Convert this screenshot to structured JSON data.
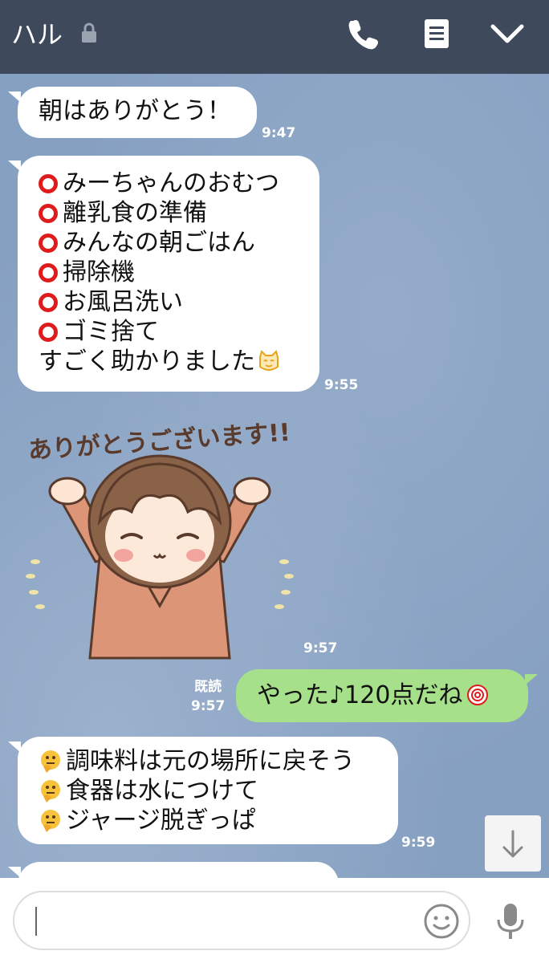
{
  "header": {
    "title": "ハル",
    "icons": [
      "lock-icon",
      "phone-icon",
      "notes-icon",
      "chevron-down-icon"
    ]
  },
  "messages": [
    {
      "side": "left",
      "type": "text",
      "lines": [
        "朝はありがとう！"
      ],
      "time": "9:47"
    },
    {
      "side": "left",
      "type": "text",
      "lines": [
        "みーちゃんのおむつ",
        "離乳食の準備",
        "みんなの朝ごはん",
        "掃除機",
        "お風呂洗い",
        "ゴミ捨て",
        "すごく助かりました"
      ],
      "time": "9:55"
    },
    {
      "side": "left",
      "type": "sticker",
      "sticker_text": "ありがとうございます!!",
      "time": "9:57"
    },
    {
      "side": "right",
      "type": "text",
      "lines": [
        "やった♪120点だね"
      ],
      "time": "9:57",
      "read_label": "既読"
    },
    {
      "side": "left",
      "type": "text",
      "lines": [
        "調味料は元の場所に戻そう",
        "食器は水につけて",
        "ジャージ脱ぎっぱ"
      ],
      "time": "9:59"
    }
  ],
  "input": {
    "placeholder": ""
  },
  "colors": {
    "header_bg": "#3e4a5c",
    "chat_bg": "#86a0c2",
    "sent_bubble": "#a7e08a",
    "received_bubble": "#ffffff",
    "circle": "#e01b1b"
  }
}
